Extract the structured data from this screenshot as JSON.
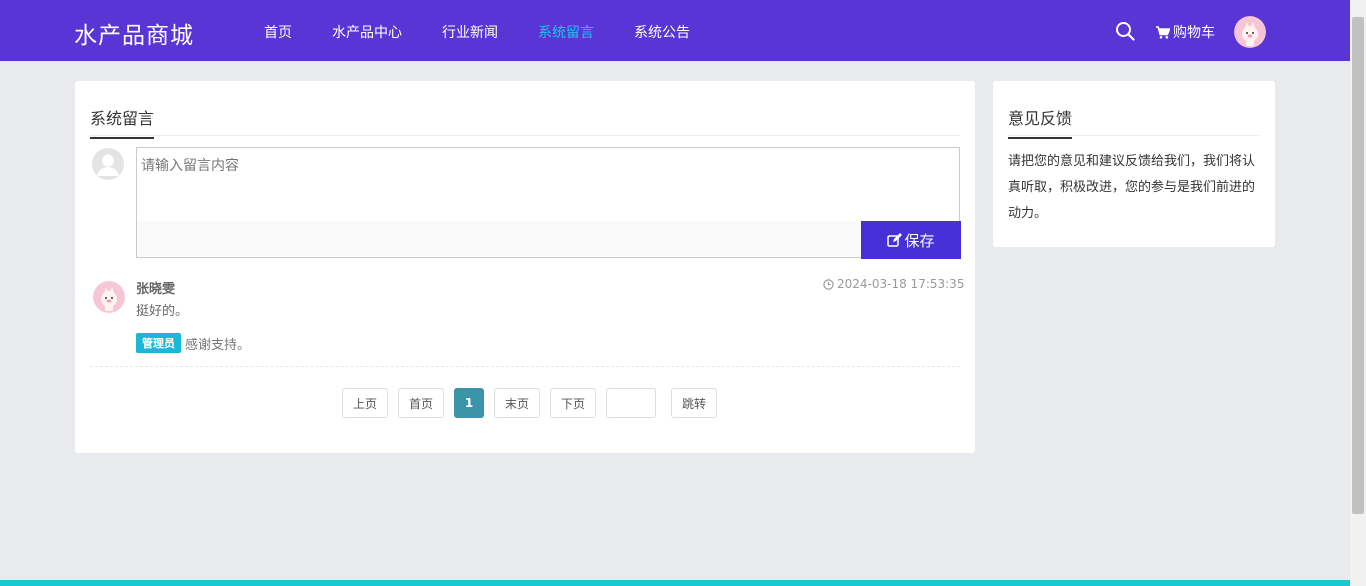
{
  "header": {
    "brand": "水产品商城",
    "nav": [
      {
        "label": "首页",
        "active": false
      },
      {
        "label": "水产品中心",
        "active": false
      },
      {
        "label": "行业新闻",
        "active": false
      },
      {
        "label": "系统留言",
        "active": true
      },
      {
        "label": "系统公告",
        "active": false
      }
    ],
    "cart_label": "购物车",
    "accent_color": "#5a35d6",
    "active_color": "#1dc5e8"
  },
  "main": {
    "section_title": "系统留言",
    "input": {
      "placeholder": "请输入留言内容",
      "value": ""
    },
    "save_label": "保存",
    "comment": {
      "user": "张晓雯",
      "time": "2024-03-18 17:53:35",
      "text": "挺好的。",
      "admin_badge": "管理员",
      "admin_reply": "感谢支持。"
    },
    "pager": {
      "prev": "上页",
      "first": "首页",
      "current": "1",
      "last": "末页",
      "next": "下页",
      "jump": "跳转"
    }
  },
  "side": {
    "title": "意见反馈",
    "text": "请把您的意见和建议反馈给我们，我们将认真听取，积极改进，您的参与是我们前进的动力。"
  }
}
